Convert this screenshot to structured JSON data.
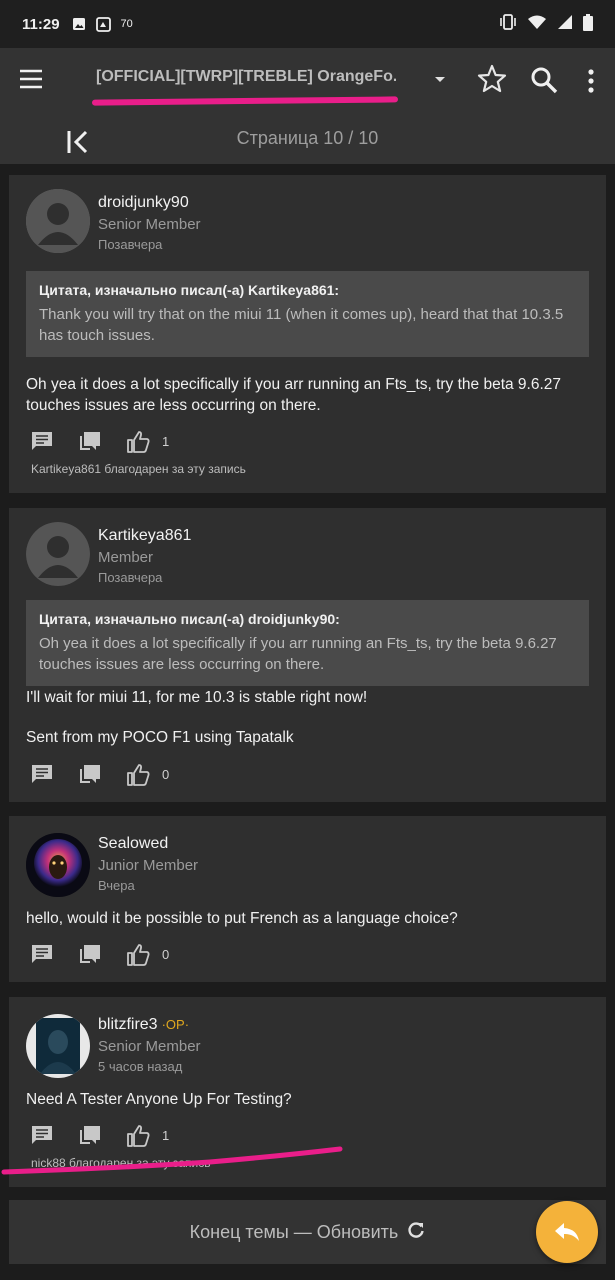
{
  "status_bar": {
    "time": "11:29",
    "notification_count": "70"
  },
  "toolbar": {
    "title": "[OFFICIAL][TWRP][TREBLE] OrangeFo...",
    "pagination": "Страница 10 / 10"
  },
  "posts": [
    {
      "author": "droidjunky90",
      "rank": "Senior Member",
      "time": "Позавчера",
      "quote": {
        "header": "Цитата, изначально писал(-а) Kartikeya861:",
        "text": "Thank you will try that on the miui 11 (when it comes up), heard that that 10.3.5 has touch issues."
      },
      "body": "Oh yea it does a lot specifically if you arr running an Fts_ts, try the beta 9.6.27 touches issues are less occurring on there.",
      "likes": "1",
      "thanks": "Kartikeya861 благодарен за эту запись"
    },
    {
      "author": "Kartikeya861",
      "rank": "Member",
      "time": "Позавчера",
      "quote": {
        "header": "Цитата, изначально писал(-а) droidjunky90:",
        "text": "Oh yea it does a lot specifically if you arr running an Fts_ts, try the beta 9.6.27 touches issues are less occurring on there."
      },
      "body_line1": "I'll wait for miui 11, for me 10.3 is stable right now!",
      "body_line2": "Sent from my POCO F1 using Tapatalk",
      "likes": "0"
    },
    {
      "author": "Sealowed",
      "rank": "Junior Member",
      "time": "Вчера",
      "body": "hello, would it be possible to put French as a language choice?",
      "likes": "0"
    },
    {
      "author": "blitzfire3",
      "op_tag": "·OP·",
      "rank": "Senior Member",
      "time": "5 часов назад",
      "body": "Need A Tester Anyone Up For Testing?",
      "likes": "1",
      "thanks": "nick88 благодарен за эту запись"
    }
  ],
  "footer": {
    "end_label": "Конец темы — Обновить"
  },
  "colors": {
    "accent": "#f4b23a",
    "annotation": "#e91e8a",
    "op_tag": "#e0a81e"
  }
}
